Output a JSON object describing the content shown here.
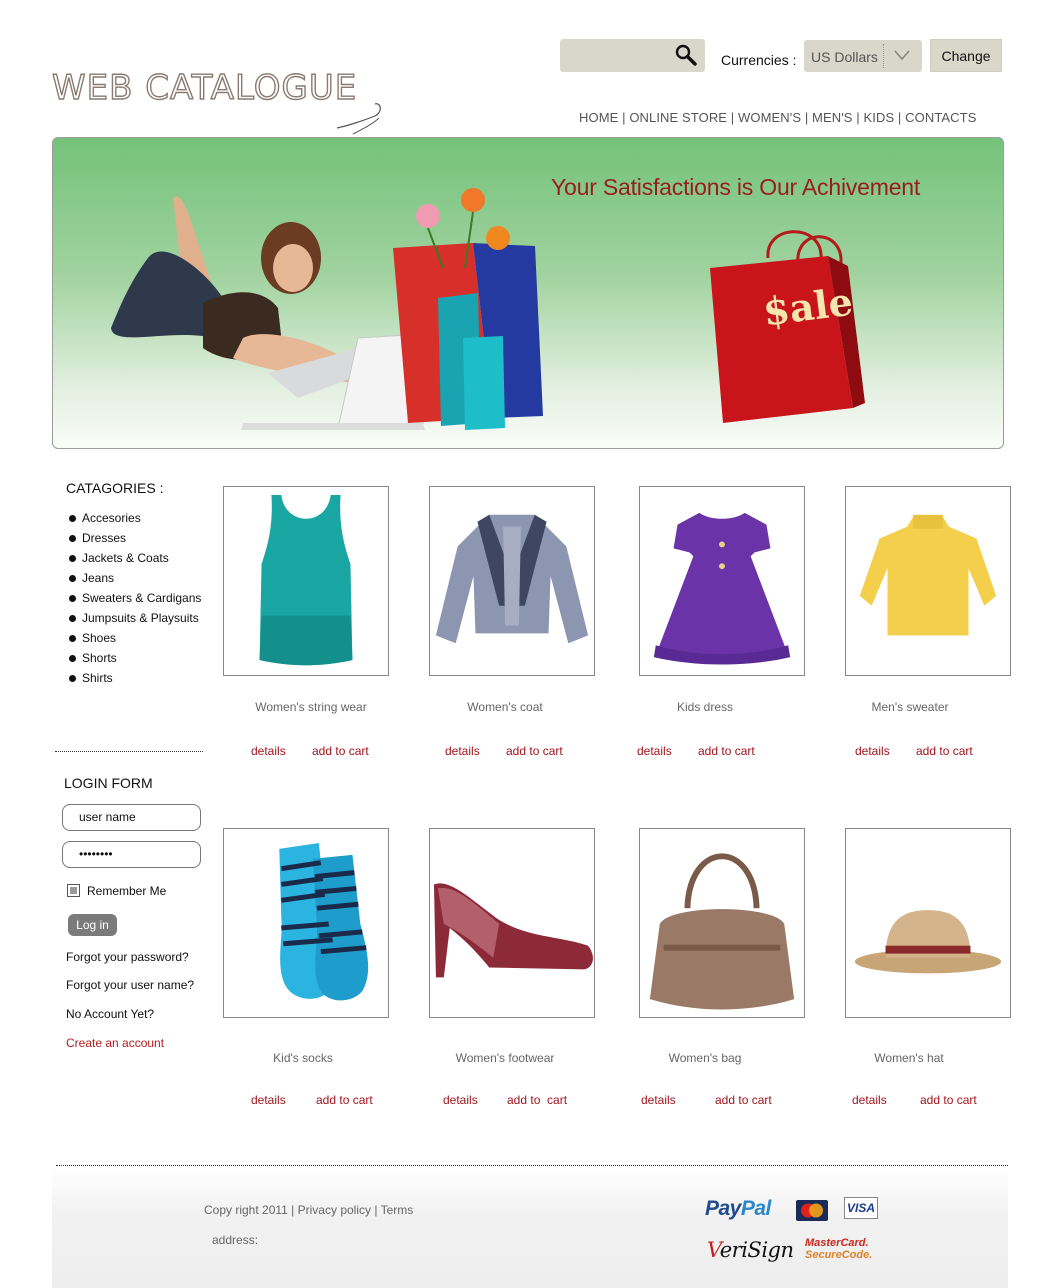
{
  "logo": {
    "text": "WEB CATALOGUE"
  },
  "header": {
    "currency_label": "Currencies :",
    "currency_value": "US Dollars",
    "change_label": "Change",
    "search_placeholder": ""
  },
  "nav": {
    "home": "HOME",
    "online_store": "ONLINE STORE",
    "womens": "WOMEN'S",
    "mens": "MEN'S",
    "kids": "KIDS",
    "contacts": "CONTACTS"
  },
  "banner": {
    "slogan": "Your Satisfactions is Our Achivement",
    "sale_bag_text": "$ale"
  },
  "categories": {
    "title": "CATAGORIES :",
    "items": [
      "Accesories",
      "Dresses",
      "Jackets & Coats",
      "Jeans",
      "Sweaters & Cardigans",
      "Jumpsuits & Playsuits",
      "Shoes",
      "Shorts",
      "Shirts"
    ]
  },
  "login": {
    "title": "LOGIN FORM",
    "username_value": "user name",
    "password_value": "••••••••",
    "remember_label": "Remember Me",
    "login_label": "Log in",
    "forgot_password": "Forgot your password?",
    "forgot_username": "Forgot your user name?",
    "no_account": "No Account Yet?",
    "create_account": "Create an account"
  },
  "products": [
    {
      "name": "Women's string wear",
      "details": "details",
      "cart": "add to cart",
      "icon": "tank-top-image"
    },
    {
      "name": "Women's  coat",
      "details": "details",
      "cart": "add to cart",
      "icon": "coat-image"
    },
    {
      "name": "Kids dress",
      "details": "details",
      "cart": "add to cart",
      "icon": "dress-image"
    },
    {
      "name": "Men's sweater",
      "details": "details",
      "cart": "add to cart",
      "icon": "sweater-image"
    },
    {
      "name": "Kid's socks",
      "details": "details",
      "cart": "add to cart",
      "icon": "socks-image"
    },
    {
      "name": "Women's footwear",
      "details": "details",
      "cart": "add to  cart",
      "icon": "shoe-image"
    },
    {
      "name": "Women's bag",
      "details": "details",
      "cart": "add to cart",
      "icon": "bag-image"
    },
    {
      "name": "Women's hat",
      "details": "details",
      "cart": "add to cart",
      "icon": "hat-image"
    }
  ],
  "footer": {
    "copyright": "Copy right 2011",
    "privacy": "Privacy policy",
    "terms": "Terms",
    "address": "address:",
    "paypal_1": "Pay",
    "paypal_2": "Pal",
    "visa": "VISA",
    "verisign_v": "V",
    "verisign_rest": "eriSign",
    "mc_secure_1": "MasterCard.",
    "mc_secure_2": "SecureCode."
  },
  "colors": {
    "accent_red": "#a0141c",
    "banner_green": "#74c27a",
    "control_bg": "#d9d6ca"
  }
}
